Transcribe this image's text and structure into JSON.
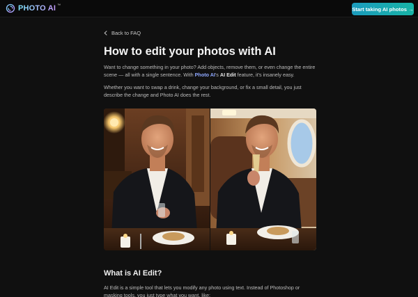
{
  "header": {
    "logo_text": "PHOTO AI",
    "logo_tm": "™",
    "logo_icon": "spiral-logo-icon",
    "cta_label": "Start taking AI photos →",
    "cta_colors": [
      "#1b9bbd",
      "#18b4a6"
    ]
  },
  "breadcrumb": {
    "back_label": "Back to FAQ",
    "icon": "chevron-left-icon"
  },
  "article": {
    "title": "How to edit your photos with AI",
    "intro_part1": "Want to change something in your photo? Add objects, remove them, or even change the entire scene — all with a single sentence. With ",
    "intro_link": "Photo AI",
    "intro_part2": "'s ",
    "intro_strong": "AI Edit",
    "intro_part3": " feature, it's insanely easy.",
    "paragraph2": "Whether you want to swap a drink, change your background, or fix a small detail, you just describe the change and Photo AI does the rest.",
    "image_subject": "before-after-edit-photo",
    "section_title": "What is AI Edit?",
    "section_paragraph": "AI Edit is a simple tool that lets you modify any photo using text. Instead of Photoshop or masking tools, you just type what you want, like:"
  },
  "colors": {
    "background": "#101010",
    "link": "#8fa8ff"
  }
}
